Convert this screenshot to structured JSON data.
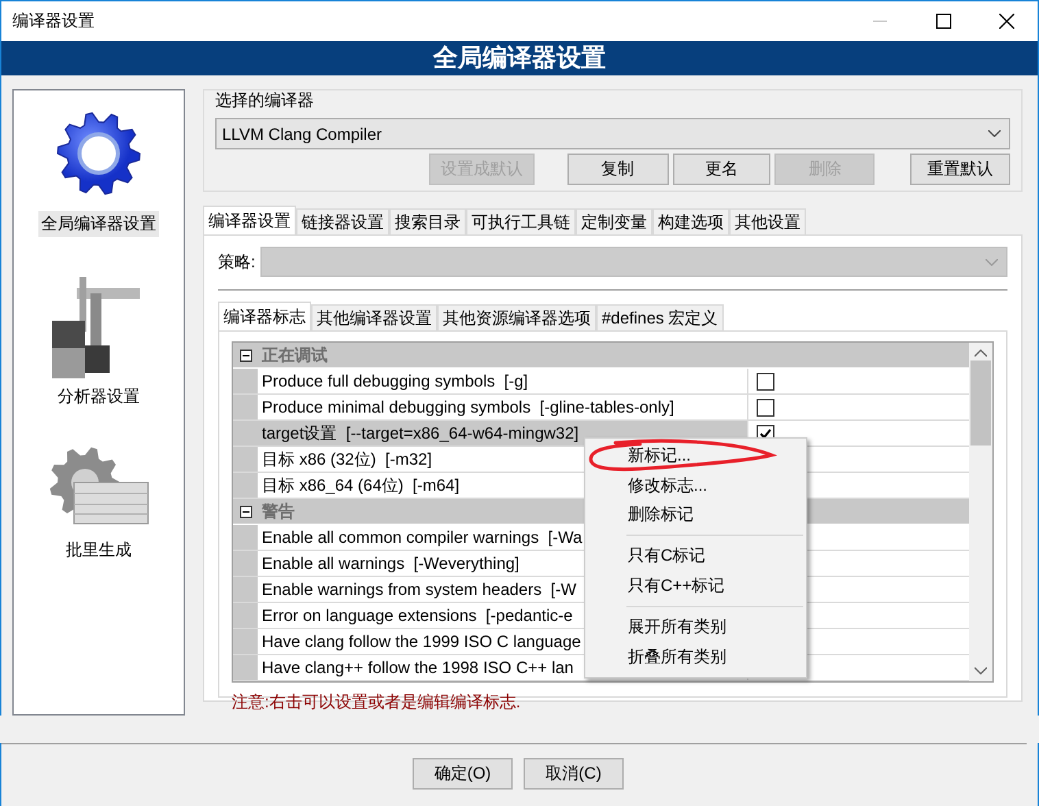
{
  "window": {
    "title": "编译器设置"
  },
  "header": {
    "title": "全局编译器设置"
  },
  "sidebar": {
    "items": [
      {
        "label": "全局编译器设置",
        "kind": "gear",
        "selected": true
      },
      {
        "label": "分析器设置",
        "kind": "caliper",
        "selected": false
      },
      {
        "label": "批里生成",
        "kind": "batch",
        "selected": false
      }
    ]
  },
  "compiler_group": {
    "title": "选择的编译器",
    "compiler": "LLVM Clang Compiler",
    "buttons": [
      {
        "label": "设置成默认",
        "disabled": true
      },
      {
        "label": "复制",
        "disabled": false
      },
      {
        "label": "更名",
        "disabled": false
      },
      {
        "label": "删除",
        "disabled": true
      },
      {
        "label": "重置默认",
        "disabled": false
      }
    ]
  },
  "tabs": [
    {
      "label": "编译器设置",
      "selected": true
    },
    {
      "label": "链接器设置",
      "selected": false
    },
    {
      "label": "搜索目录",
      "selected": false
    },
    {
      "label": "可执行工具链",
      "selected": false
    },
    {
      "label": "定制变量",
      "selected": false
    },
    {
      "label": "构建选项",
      "selected": false
    },
    {
      "label": "其他设置",
      "selected": false
    }
  ],
  "policy": {
    "label": "策略:",
    "disabled": true
  },
  "sub_tabs": [
    {
      "label": "编译器标志",
      "selected": true
    },
    {
      "label": "其他编译器设置",
      "selected": false
    },
    {
      "label": "其他资源编译器选项",
      "selected": false
    },
    {
      "label": "#defines 宏定义",
      "selected": false
    }
  ],
  "flags": {
    "groups": [
      {
        "title": "正在调试",
        "expanded": true,
        "children": [
          {
            "label": "Produce full debugging symbols  [-g]",
            "checked": false,
            "selected": false
          },
          {
            "label": "Produce minimal debugging symbols  [-gline-tables-only]",
            "checked": false,
            "selected": false
          },
          {
            "label": "target设置  [--target=x86_64-w64-mingw32]",
            "checked": true,
            "selected": true
          },
          {
            "label": "目标 x86 (32位)  [-m32]",
            "selected": false
          },
          {
            "label": "目标 x86_64 (64位)  [-m64]",
            "selected": false
          }
        ]
      },
      {
        "title": "警告",
        "expanded": true,
        "children": [
          {
            "label": "Enable all common compiler warnings  [-Wa",
            "selected": false
          },
          {
            "label": "Enable all warnings  [-Weverything]",
            "selected": false
          },
          {
            "label": "Enable warnings from system headers  [-W",
            "selected": false
          },
          {
            "label": "Error on language extensions  [-pedantic-e",
            "selected": false
          },
          {
            "label": "Have clang follow the 1999 ISO C language",
            "selected": false
          },
          {
            "label": "Have clang++ follow the 1998 ISO C++ lan",
            "selected": false
          }
        ]
      }
    ]
  },
  "note": "注意:右击可以设置或者是编辑编译标志.",
  "context_menu": {
    "items": [
      {
        "kind": "item",
        "label": "新标记...",
        "circled": true
      },
      {
        "kind": "item",
        "label": "修改标志...",
        "circled": false
      },
      {
        "kind": "item",
        "label": "删除标记",
        "circled": false
      },
      {
        "kind": "separator"
      },
      {
        "kind": "item",
        "label": "只有C标记",
        "circled": false
      },
      {
        "kind": "item",
        "label": "只有C++标记",
        "circled": false
      },
      {
        "kind": "separator"
      },
      {
        "kind": "item",
        "label": "展开所有类别",
        "circled": false
      },
      {
        "kind": "item",
        "label": "折叠所有类别",
        "circled": false
      }
    ]
  },
  "dialog_buttons": [
    {
      "label": "确定(O)"
    },
    {
      "label": "取消(C)"
    }
  ]
}
